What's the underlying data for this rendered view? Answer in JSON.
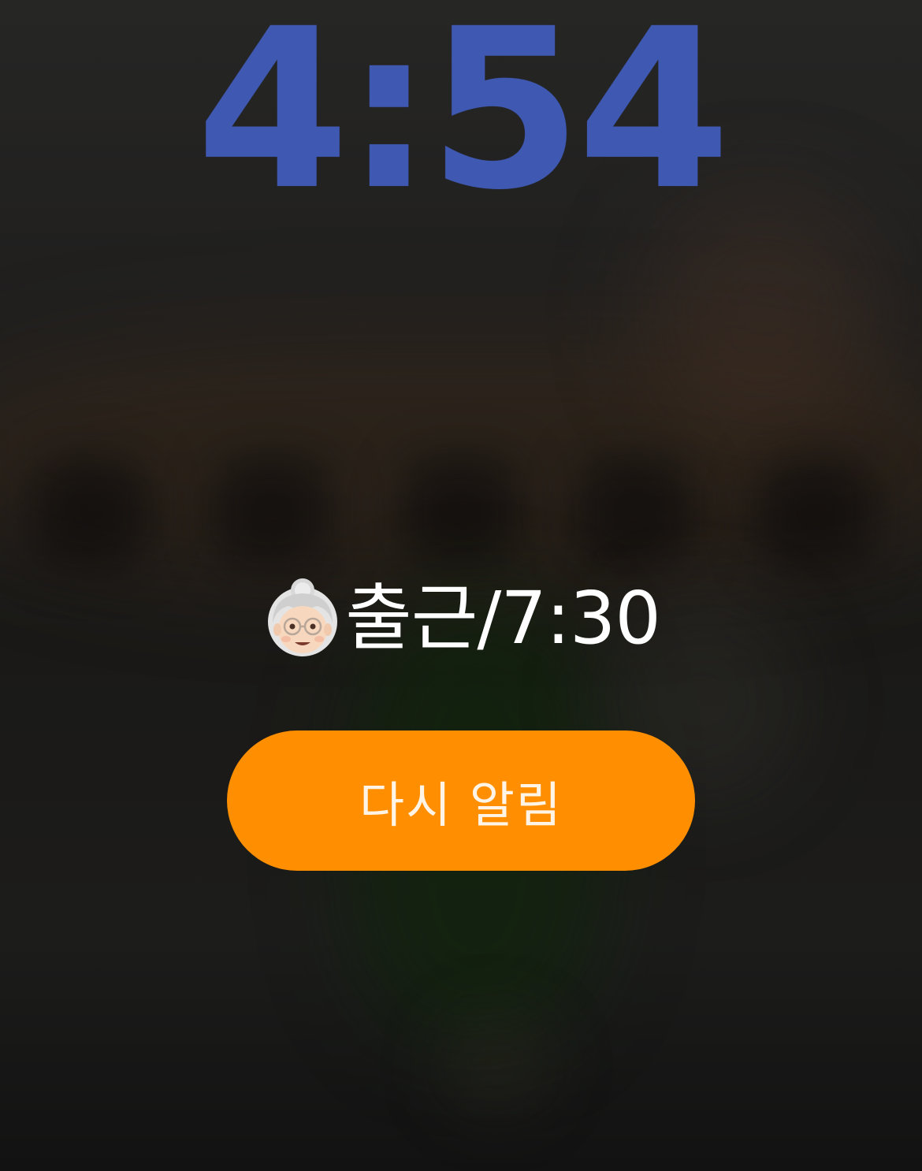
{
  "lock_screen": {
    "time": "4:54",
    "time_color": "#3f58b1"
  },
  "alarm": {
    "emoji_icon": "older-woman-emoji",
    "label": "출근/7:30"
  },
  "snooze": {
    "label": "다시 알림",
    "color": "#ff8f00"
  }
}
